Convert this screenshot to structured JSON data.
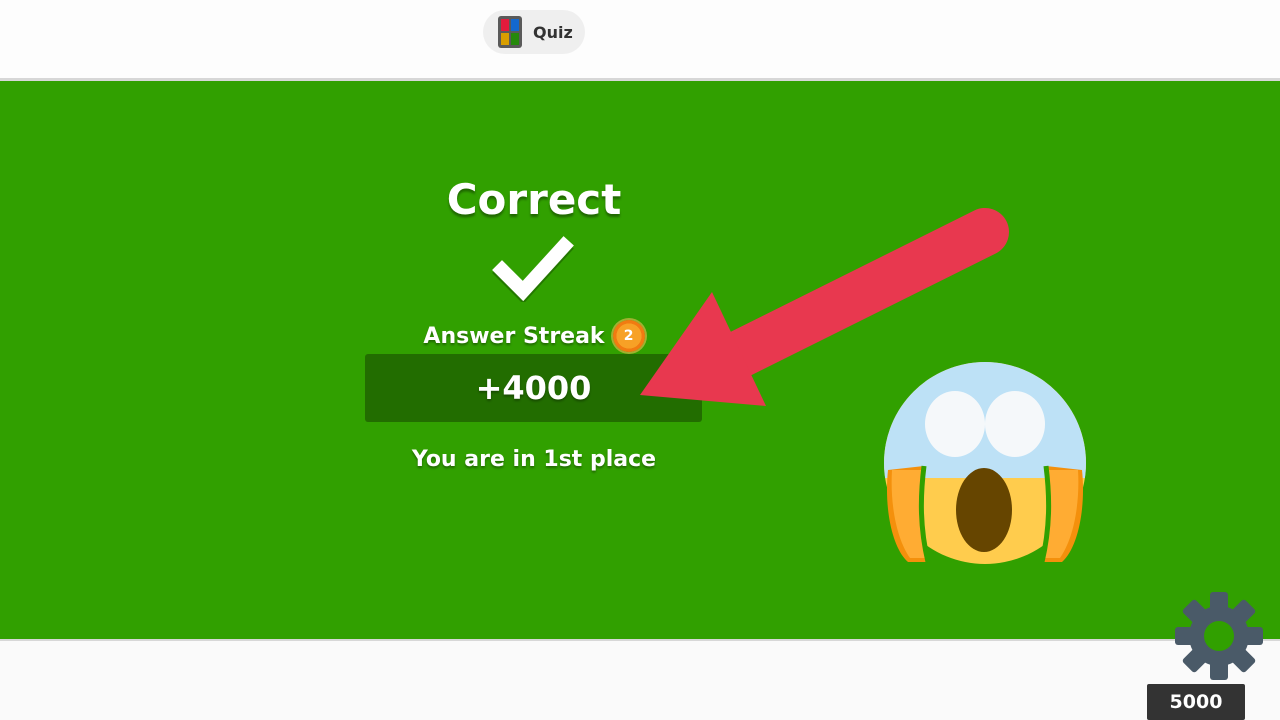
{
  "header": {
    "quiz_label": "Quiz",
    "quiz_icon": "quiz-app-icon"
  },
  "result": {
    "title": "Correct",
    "check_icon": "checkmark-icon",
    "streak_label": "Answer Streak",
    "streak_count": "2",
    "points": "+4000",
    "place_text": "You are in 1st place"
  },
  "overlay": {
    "arrow": "red-arrow",
    "emoji": "screaming-face-emoji"
  },
  "footer": {
    "settings_icon": "gear-icon",
    "score": "5000"
  },
  "colors": {
    "background_green": "#31a000",
    "points_box": "#226d00",
    "arrow_red": "#e8384f",
    "score_box": "#333333",
    "streak_badge": "#f17b11"
  }
}
